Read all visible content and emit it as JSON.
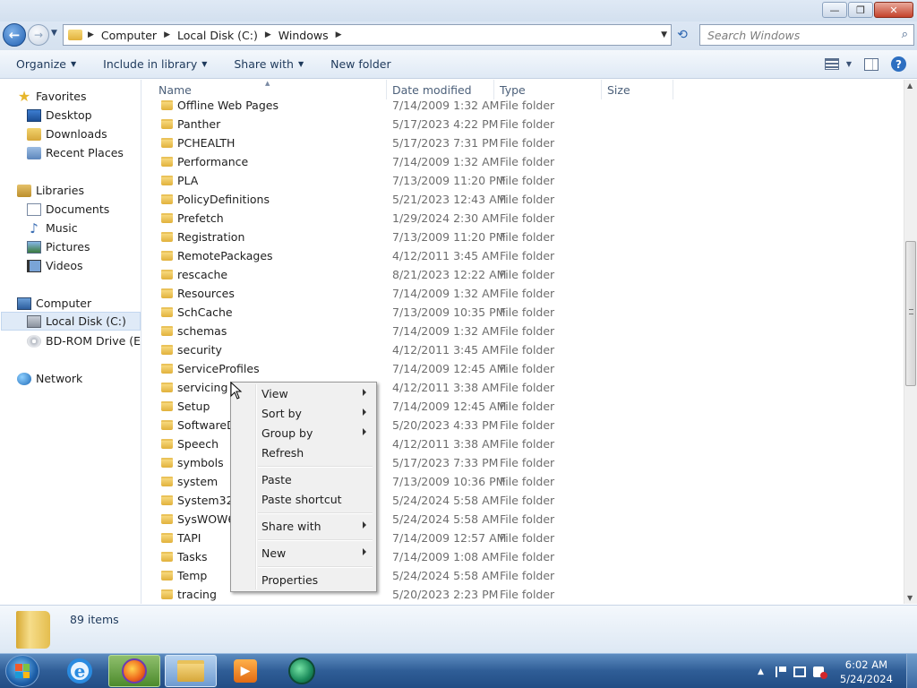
{
  "window": {
    "controls": {
      "minimize": "—",
      "maximize": "❐",
      "close": "✕"
    }
  },
  "address": {
    "breadcrumbs": [
      "Computer",
      "Local Disk (C:)",
      "Windows"
    ],
    "search_placeholder": "Search Windows"
  },
  "toolbar": {
    "organize": "Organize",
    "include_in_library": "Include in library",
    "share_with": "Share with",
    "new_folder": "New folder"
  },
  "sidebar": {
    "items": [
      {
        "label": "Favorites",
        "icon": "star-icon"
      },
      {
        "label": "Desktop",
        "icon": "desktop-icon"
      },
      {
        "label": "Downloads",
        "icon": "downloads-icon"
      },
      {
        "label": "Recent Places",
        "icon": "recent-places-icon"
      },
      {
        "label": "Libraries",
        "icon": "libraries-icon"
      },
      {
        "label": "Documents",
        "icon": "documents-icon"
      },
      {
        "label": "Music",
        "icon": "music-icon"
      },
      {
        "label": "Pictures",
        "icon": "pictures-icon"
      },
      {
        "label": "Videos",
        "icon": "videos-icon"
      },
      {
        "label": "Computer",
        "icon": "computer-icon"
      },
      {
        "label": "Local Disk (C:)",
        "icon": "disk-icon",
        "selected": true
      },
      {
        "label": "BD-ROM Drive (E:) G",
        "icon": "bd-rom-icon"
      },
      {
        "label": "Network",
        "icon": "network-icon"
      }
    ]
  },
  "columns": {
    "name": "Name",
    "date_modified": "Date modified",
    "type": "Type",
    "size": "Size"
  },
  "files": [
    {
      "name": "Offline Web Pages",
      "date": "7/14/2009 1:32 AM",
      "type": "File folder"
    },
    {
      "name": "Panther",
      "date": "5/17/2023 4:22 PM",
      "type": "File folder"
    },
    {
      "name": "PCHEALTH",
      "date": "5/17/2023 7:31 PM",
      "type": "File folder"
    },
    {
      "name": "Performance",
      "date": "7/14/2009 1:32 AM",
      "type": "File folder"
    },
    {
      "name": "PLA",
      "date": "7/13/2009 11:20 PM",
      "type": "File folder"
    },
    {
      "name": "PolicyDefinitions",
      "date": "5/21/2023 12:43 AM",
      "type": "File folder"
    },
    {
      "name": "Prefetch",
      "date": "1/29/2024 2:30 AM",
      "type": "File folder"
    },
    {
      "name": "Registration",
      "date": "7/13/2009 11:20 PM",
      "type": "File folder"
    },
    {
      "name": "RemotePackages",
      "date": "4/12/2011 3:45 AM",
      "type": "File folder"
    },
    {
      "name": "rescache",
      "date": "8/21/2023 12:22 AM",
      "type": "File folder"
    },
    {
      "name": "Resources",
      "date": "7/14/2009 1:32 AM",
      "type": "File folder"
    },
    {
      "name": "SchCache",
      "date": "7/13/2009 10:35 PM",
      "type": "File folder"
    },
    {
      "name": "schemas",
      "date": "7/14/2009 1:32 AM",
      "type": "File folder"
    },
    {
      "name": "security",
      "date": "4/12/2011 3:45 AM",
      "type": "File folder"
    },
    {
      "name": "ServiceProfiles",
      "date": "7/14/2009 12:45 AM",
      "type": "File folder"
    },
    {
      "name": "servicing",
      "date": "4/12/2011 3:38 AM",
      "type": "File folder"
    },
    {
      "name": "Setup",
      "date": "7/14/2009 12:45 AM",
      "type": "File folder"
    },
    {
      "name": "SoftwareDi",
      "date": "5/20/2023 4:33 PM",
      "type": "File folder"
    },
    {
      "name": "Speech",
      "date": "4/12/2011 3:38 AM",
      "type": "File folder"
    },
    {
      "name": "symbols",
      "date": "5/17/2023 7:33 PM",
      "type": "File folder"
    },
    {
      "name": "system",
      "date": "7/13/2009 10:36 PM",
      "type": "File folder"
    },
    {
      "name": "System32",
      "date": "5/24/2024 5:58 AM",
      "type": "File folder"
    },
    {
      "name": "SysWOW64",
      "date": "5/24/2024 5:58 AM",
      "type": "File folder"
    },
    {
      "name": "TAPI",
      "date": "7/14/2009 12:57 AM",
      "type": "File folder"
    },
    {
      "name": "Tasks",
      "date": "7/14/2009 1:08 AM",
      "type": "File folder"
    },
    {
      "name": "Temp",
      "date": "5/24/2024 5:58 AM",
      "type": "File folder"
    },
    {
      "name": "tracing",
      "date": "5/20/2023 2:23 PM",
      "type": "File folder"
    }
  ],
  "context_menu": {
    "items": [
      {
        "label": "View",
        "submenu": true
      },
      {
        "label": "Sort by",
        "submenu": true
      },
      {
        "label": "Group by",
        "submenu": true
      },
      {
        "label": "Refresh",
        "submenu": false
      },
      {
        "separator": true
      },
      {
        "label": "Paste",
        "submenu": false
      },
      {
        "label": "Paste shortcut",
        "submenu": false
      },
      {
        "separator": true
      },
      {
        "label": "Share with",
        "submenu": true
      },
      {
        "separator": true
      },
      {
        "label": "New",
        "submenu": true
      },
      {
        "separator": true
      },
      {
        "label": "Properties",
        "submenu": false
      }
    ]
  },
  "details": {
    "item_count": "89 items"
  },
  "taskbar": {
    "apps": [
      "internet-explorer-icon",
      "firefox-icon",
      "windows-explorer-icon",
      "media-player-icon",
      "green-app-icon"
    ],
    "clock_time": "6:02 AM",
    "clock_date": "5/24/2024"
  }
}
